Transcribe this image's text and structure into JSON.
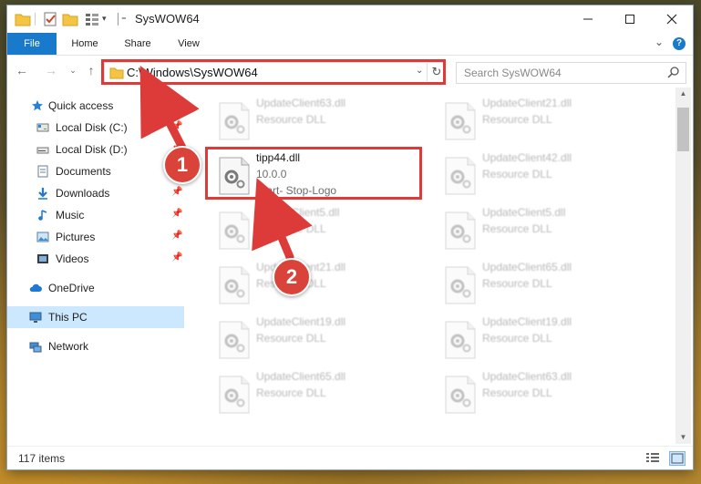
{
  "window": {
    "title": "SysWOW64"
  },
  "ribbon": {
    "tabs": [
      "File",
      "Home",
      "Share",
      "View"
    ],
    "help": "?"
  },
  "navbar": {
    "address": "C:\\Windows\\SysWOW64",
    "search_placeholder": "Search SysWOW64"
  },
  "sidebar": {
    "items": [
      {
        "label": "Quick access",
        "icon": "star-icon",
        "pinned": false
      },
      {
        "label": "Local Disk (C:)",
        "icon": "drive-icon",
        "pinned": true
      },
      {
        "label": "Local Disk (D:)",
        "icon": "drive-icon",
        "pinned": true
      },
      {
        "label": "Documents",
        "icon": "document-icon",
        "pinned": true
      },
      {
        "label": "Downloads",
        "icon": "download-icon",
        "pinned": true
      },
      {
        "label": "Music",
        "icon": "music-icon",
        "pinned": true
      },
      {
        "label": "Pictures",
        "icon": "pictures-icon",
        "pinned": true
      },
      {
        "label": "Videos",
        "icon": "video-icon",
        "pinned": true
      },
      {
        "label": "OneDrive",
        "icon": "cloud-icon",
        "pinned": false
      },
      {
        "label": "This PC",
        "icon": "computer-icon",
        "pinned": false,
        "selected": true
      },
      {
        "label": "Network",
        "icon": "network-icon",
        "pinned": false
      }
    ]
  },
  "files": {
    "left": [
      {
        "name": "UpdateClient63.dll",
        "lines": [
          "Resource DLL"
        ],
        "blurred": true
      },
      {
        "name": "tipp44.dll",
        "lines": [
          "10.0.0",
          "Start- Stop-Logo"
        ],
        "blurred": false
      },
      {
        "name": "UpdateClient5.dll",
        "lines": [
          "Resource DLL"
        ],
        "blurred": true
      },
      {
        "name": "UpdateClient21.dll",
        "lines": [
          "Resource DLL"
        ],
        "blurred": true
      },
      {
        "name": "UpdateClient19.dll",
        "lines": [
          "Resource DLL"
        ],
        "blurred": true
      },
      {
        "name": "UpdateClient65.dll",
        "lines": [
          "Resource DLL"
        ],
        "blurred": true
      }
    ],
    "right": [
      {
        "name": "UpdateClient21.dll",
        "lines": [
          "Resource DLL"
        ],
        "blurred": true
      },
      {
        "name": "UpdateClient42.dll",
        "lines": [
          "Resource DLL"
        ],
        "blurred": true
      },
      {
        "name": "UpdateClient5.dll",
        "lines": [
          "Resource DLL"
        ],
        "blurred": true
      },
      {
        "name": "UpdateClient65.dll",
        "lines": [
          "Resource DLL"
        ],
        "blurred": true
      },
      {
        "name": "UpdateClient19.dll",
        "lines": [
          "Resource DLL"
        ],
        "blurred": true
      },
      {
        "name": "UpdateClient63.dll",
        "lines": [
          "Resource DLL"
        ],
        "blurred": true
      }
    ]
  },
  "status": {
    "count": "117 items"
  },
  "annotations": {
    "step1": "1",
    "step2": "2",
    "color": "#dd3a3a"
  }
}
